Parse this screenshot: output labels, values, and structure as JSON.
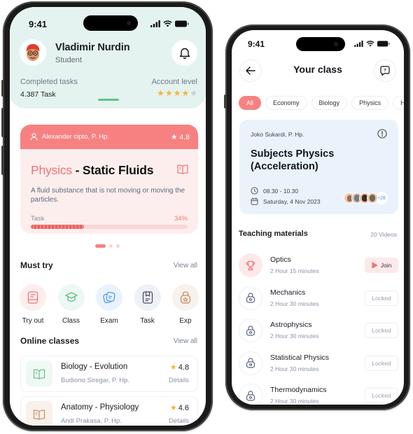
{
  "status_bar": {
    "time": "9:41"
  },
  "home": {
    "user": {
      "name": "Vladimir Nurdin",
      "role": "Student"
    },
    "stats": {
      "completed_label": "Completed tasks",
      "completed_value": "4.387 Task",
      "level_label": "Account level",
      "level_stars": 4,
      "level_max": 5
    },
    "featured": {
      "teacher": "Alexander cipto, P. Hp.",
      "rating": "4.8",
      "subject": "Physics",
      "separator": " - ",
      "topic": "Static Fluids",
      "description": "A fluid substance that is not moving or moving the particles.",
      "task_label": "Task",
      "task_percent_label": "34%",
      "task_progress": 0.34,
      "carousel_pages": 3,
      "carousel_active": 0
    },
    "must_try": {
      "title": "Must try",
      "view_all": "View all",
      "items": [
        {
          "label": "Try out",
          "icon": "notebook-icon",
          "color": "#f27373",
          "bg": "#fdeeee"
        },
        {
          "label": "Class",
          "icon": "graduation-cap-icon",
          "color": "#5cbf85",
          "bg": "#eef8f2"
        },
        {
          "label": "Exam",
          "icon": "exam-cards-icon",
          "color": "#4a9be8",
          "bg": "#eaf3fc"
        },
        {
          "label": "Task",
          "icon": "task-board-icon",
          "color": "#4a5268",
          "bg": "#eef1f6"
        },
        {
          "label": "Exp",
          "icon": "badge-lock-icon",
          "color": "#c98a5c",
          "bg": "#f8f1ec"
        }
      ]
    },
    "online_classes": {
      "title": "Online classes",
      "view_all": "View all",
      "items": [
        {
          "name": "Biology - Evolution",
          "teacher": "Budiono Siregar, P. Hp.",
          "rating": "4.8",
          "action": "Details",
          "icon_color": "#5cbf85",
          "icon_bg": "#f0f8f3"
        },
        {
          "name": "Anatomy - Physiology",
          "teacher": "Andi Prakasa, P. Hp.",
          "rating": "4.6",
          "action": "Details",
          "icon_color": "#c98a5c",
          "icon_bg": "#f8f1ec"
        }
      ]
    }
  },
  "your_class": {
    "title": "Your class",
    "filters": [
      "All",
      "Economy",
      "Biology",
      "Physics",
      "Hist"
    ],
    "active_filter": "All",
    "live_class": {
      "teacher": "Joko Sukardi, P. Hp.",
      "title": "Subjects Physics (Acceleration)",
      "time": "08.30 - 10.30",
      "date": "Saturday, 4 Nov 2023",
      "extra_attendees": "+28"
    },
    "materials": {
      "title": "Teaching materials",
      "count": "20 Videos",
      "items": [
        {
          "name": "Optics",
          "duration": "2 Hour 15 minutes",
          "action": "Join",
          "state": "active"
        },
        {
          "name": "Mechanics",
          "duration": "2 Hour 30 minutes",
          "action": "Locked",
          "state": "locked"
        },
        {
          "name": "Astrophysics",
          "duration": "2 Hour 30 minutes",
          "action": "Locked",
          "state": "locked"
        },
        {
          "name": "Statistical Physics",
          "duration": "2 Hour 30 minutes",
          "action": "Locked",
          "state": "locked"
        },
        {
          "name": "Thermodynamics",
          "duration": "2 Hour 30 minutes",
          "action": "Locked",
          "state": "locked"
        }
      ]
    }
  },
  "colors": {
    "accent": "#f78181",
    "header_bg": "#e4f3ef",
    "star": "#f5b53f",
    "star_empty": "#c8ccd4",
    "live_card_bg": "#eaf3fc"
  }
}
